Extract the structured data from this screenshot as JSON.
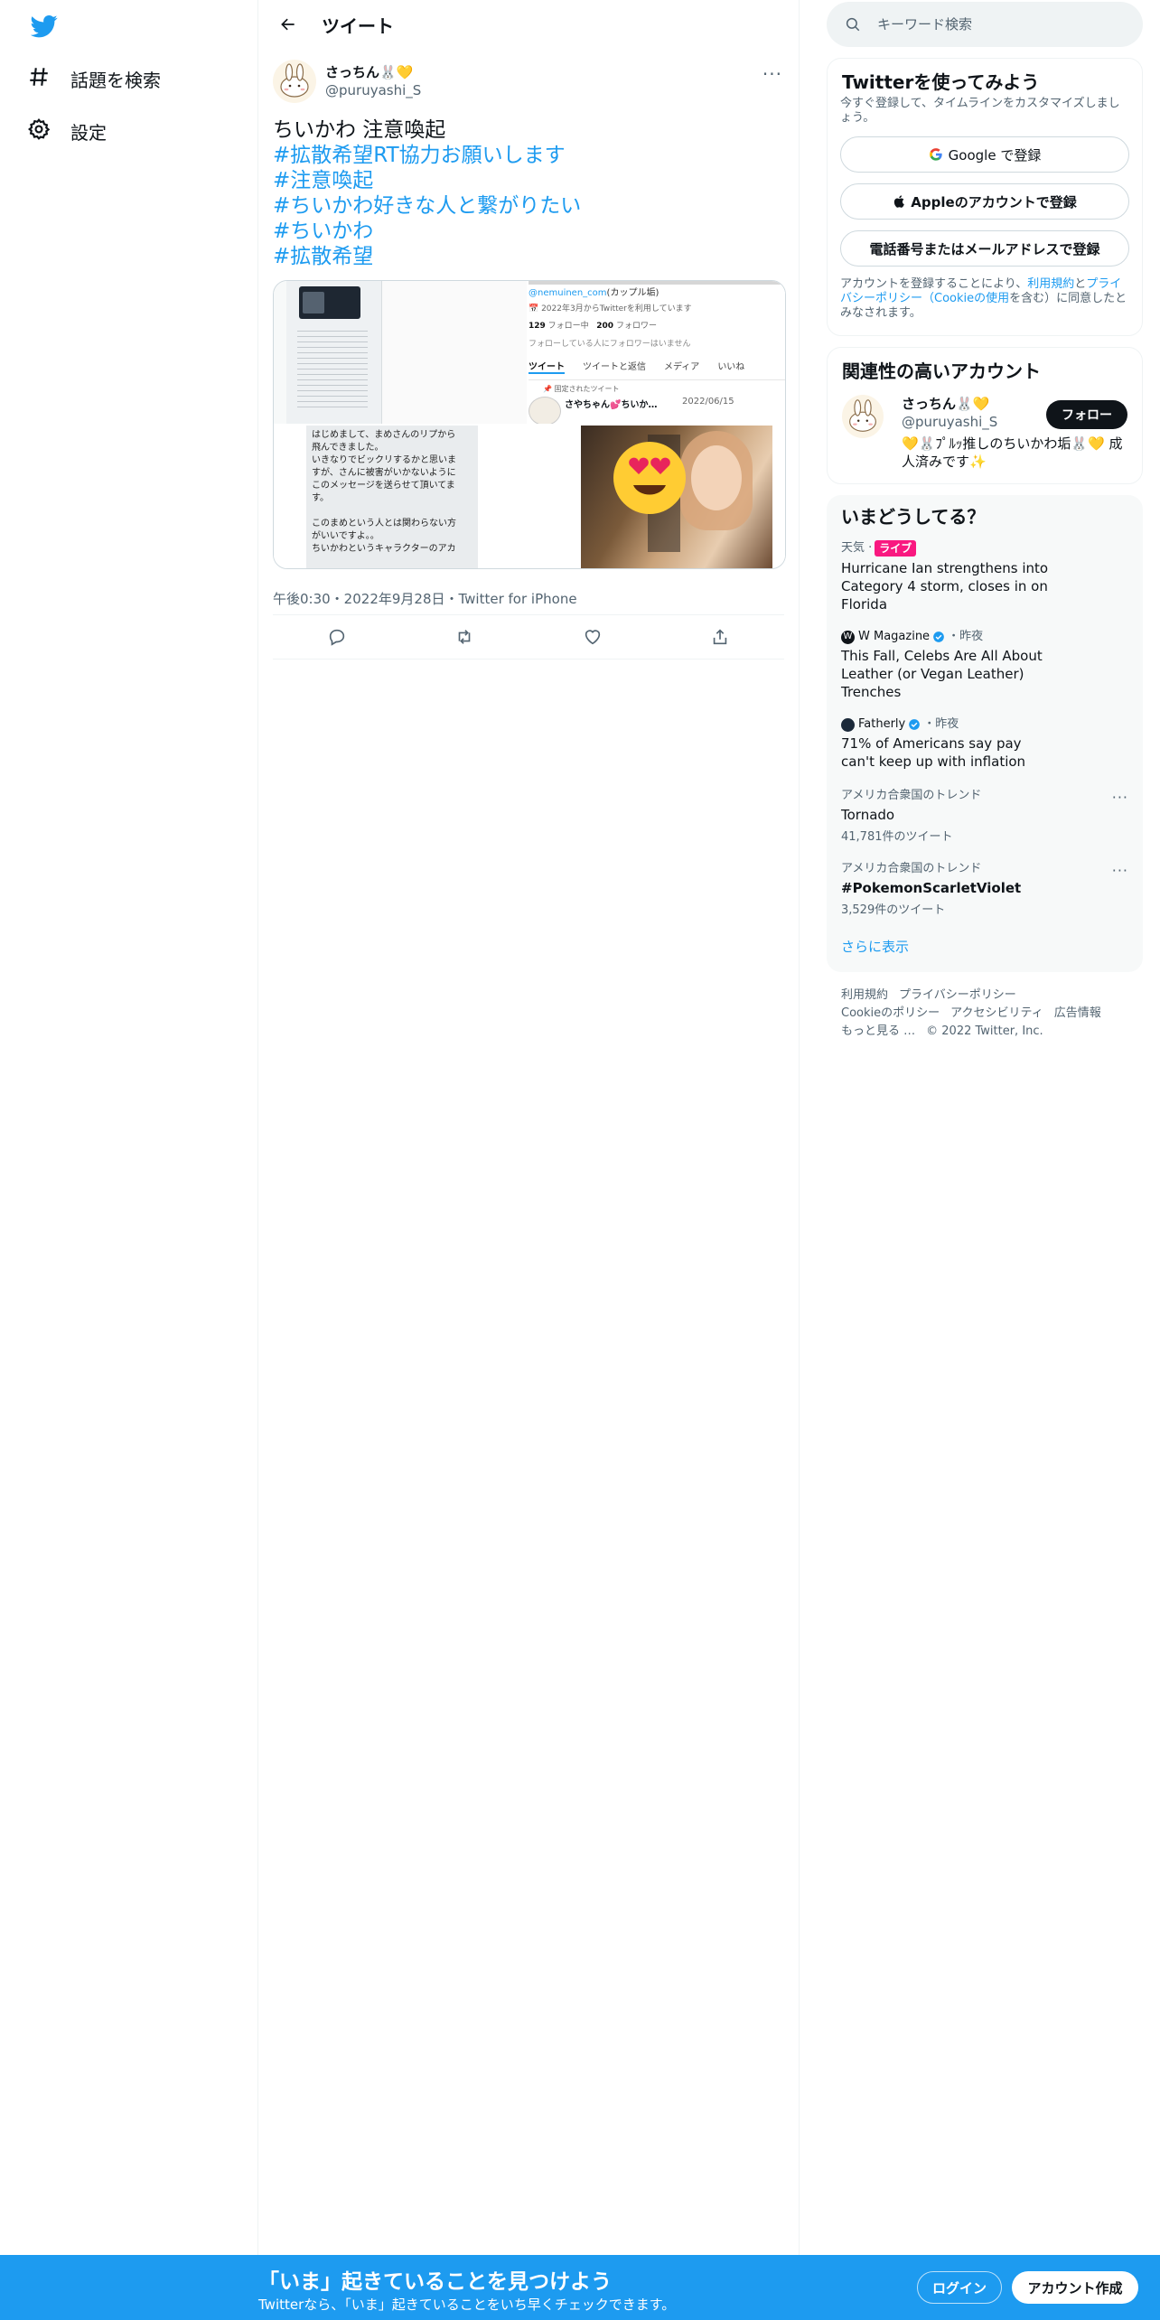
{
  "nav": {
    "logo_icon": "twitter-bird-icon",
    "items": [
      {
        "icon": "hashtag-icon",
        "label": "話題を検索"
      },
      {
        "icon": "gear-icon",
        "label": "設定"
      }
    ]
  },
  "header": {
    "title": "ツイート"
  },
  "tweet": {
    "author_name": "さっちん🐰💛",
    "author_handle": "@puruyashi_S",
    "text_plain": "ちいかわ 注意喚起",
    "hashtags": [
      "#拡散希望RT協力お願いします",
      "#注意喚起",
      "#ちいかわ好きな人と繋がりたい",
      "#ちいかわ",
      "#拡散希望"
    ],
    "meta": "午後0:30・2022年9月28日・Twitter for iPhone",
    "media": {
      "tile2_link": "@nemuinen_com",
      "tile2_link_suffix": "(カップル垢)",
      "tile2_joined": "2022年3月からTwitterを利用しています",
      "tile2_following": "129",
      "tile2_following_label": "フォロー中",
      "tile2_followers": "200",
      "tile2_followers_label": "フォロワー",
      "tile2_note": "フォローしている人にフォロワーはいません",
      "tile2_tabs": [
        "ツイート",
        "ツイートと返信",
        "メディア",
        "いいね"
      ],
      "tile2_pinned": "固定されたツイート",
      "tile2_pinned_name": "さやちゃん💕ちいか…",
      "tile2_pinned_date": "2022/06/15",
      "tile3_lines": [
        "はじめまして、まめさんのリプから",
        "飛んできました。",
        "いきなりでビックリするかと思いま",
        "すが、さんに被害がいかないように",
        "このメッセージを送らせて頂いてま",
        "す。",
        "",
        "このまめという人とは関わらない方",
        "がいいですよ。。",
        "ちいかわというキャラクターのアカ"
      ]
    },
    "actions": [
      "reply-icon",
      "retweet-icon",
      "like-icon",
      "share-icon"
    ]
  },
  "search": {
    "placeholder": "キーワード検索"
  },
  "signup_card": {
    "title": "Twitterを使ってみよう",
    "subtitle": "今すぐ登録して、タイムラインをカスタマイズしましょう。",
    "google_label": "Google で登録",
    "apple_label": "Appleのアカウントで登録",
    "phone_label": "電話番号またはメールアドレスで登録",
    "terms_prefix": "アカウントを登録することにより、",
    "terms_link1": "利用規約",
    "terms_and": "と",
    "terms_link2": "プライバシーポリシー（Cookieの使用",
    "terms_suffix": "を含む）に同意したとみなされます。"
  },
  "related": {
    "title": "関連性の高いアカウント",
    "name": "さっちん🐰💛",
    "handle": "@puruyashi_S",
    "follow_label": "フォロー",
    "bio": "💛🐰ﾌﾟﾙｯ推しのちいかわ垢🐰💛 成人済みです✨"
  },
  "trends": {
    "title": "いまどうしてる？",
    "items": [
      {
        "source": "天気",
        "badge": "ライブ",
        "title": "Hurricane Ian strengthens into Category 4 storm, closes in on Florida"
      },
      {
        "source": "W Magazine",
        "time": "・昨夜",
        "title": "This Fall, Celebs Are All About Leather (or Vegan Leather) Trenches"
      },
      {
        "source": "Fatherly",
        "time": "・昨夜",
        "title": "71% of Americans say pay can't keep up with inflation"
      },
      {
        "context": "アメリカ合衆国のトレンド",
        "title": "Tornado",
        "count": "41,781件のツイート"
      },
      {
        "context": "アメリカ合衆国のトレンド",
        "title": "#PokemonScarletViolet",
        "count": "3,529件のツイート"
      }
    ],
    "show_more": "さらに表示"
  },
  "footer": {
    "links": [
      "利用規約",
      "プライバシーポリシー",
      "Cookieのポリシー",
      "アクセシビリティ",
      "広告情報",
      "もっと見る …"
    ],
    "copyright": "© 2022 Twitter, Inc."
  },
  "bottom_bar": {
    "title": "「いま」起きていることを見つけよう",
    "subtitle": "Twitterなら、「いま」起きていることをいち早くチェックできます。",
    "login": "ログイン",
    "signup": "アカウント作成"
  },
  "colors": {
    "accent": "#1d9bf0",
    "live": "#f91880",
    "text": "#0f1419",
    "muted": "#536471"
  }
}
